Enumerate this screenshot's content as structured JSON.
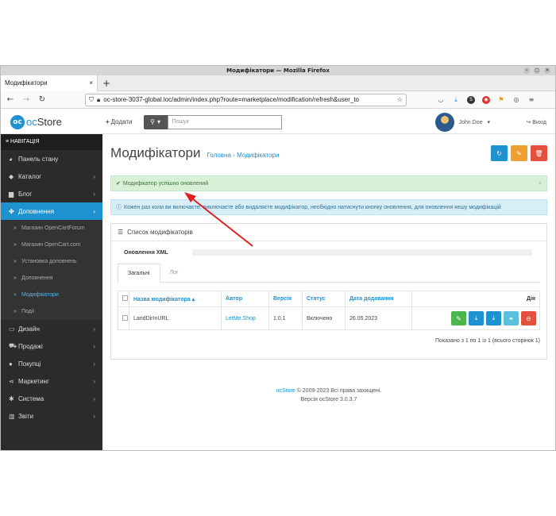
{
  "window": {
    "title": "Модифікатори — Mozilla Firefox"
  },
  "tab": {
    "label": "Модифікатори",
    "close": "×",
    "new_tab": "+"
  },
  "url": "oc-store-3037-global.loc/admin/index.php?route=marketplace/modification/refresh&user_to",
  "header": {
    "logo_mark": "oc",
    "logo_text_a": "oc",
    "logo_text_b": "Store",
    "add_label": "Додати",
    "search_placeholder": "Пошук",
    "user_name": "John Doe",
    "logout_label": "Вихід"
  },
  "sidebar": {
    "heading": "НАВІГАЦІЯ",
    "items": [
      {
        "label": "Панель стану",
        "icon": "dashboard-icon",
        "glyph": "◕",
        "chevron": ""
      },
      {
        "label": "Каталог",
        "icon": "tag-icon",
        "glyph": "◆",
        "chevron": "›"
      },
      {
        "label": "Блог",
        "icon": "book-icon",
        "glyph": "▆",
        "chevron": "›"
      },
      {
        "label": "Доповнення",
        "icon": "puzzle-icon",
        "glyph": "✤",
        "chevron": "›"
      }
    ],
    "sub_items": [
      {
        "label": "Магазин OpenCartForum"
      },
      {
        "label": "Магазин OpenCart.com"
      },
      {
        "label": "Установка доповнень"
      },
      {
        "label": "Доповнення"
      },
      {
        "label": "Модифікатори"
      },
      {
        "label": "Події"
      }
    ],
    "items2": [
      {
        "label": "Дизайн",
        "icon": "monitor-icon",
        "glyph": "▭",
        "chevron": "›"
      },
      {
        "label": "Продажі",
        "icon": "cart-icon",
        "glyph": "⛟",
        "chevron": "›"
      },
      {
        "label": "Покупці",
        "icon": "user-icon",
        "glyph": "●",
        "chevron": "›"
      },
      {
        "label": "Маркетинг",
        "icon": "share-icon",
        "glyph": "⋖",
        "chevron": "›"
      },
      {
        "label": "Система",
        "icon": "cog-icon",
        "glyph": "✱",
        "chevron": "›"
      },
      {
        "label": "Звіти",
        "icon": "bar-chart-icon",
        "glyph": "▥",
        "chevron": "›"
      }
    ]
  },
  "page": {
    "title": "Модифікатори",
    "breadcrumb_home": "Головна",
    "breadcrumb_sep": "›",
    "breadcrumb_current": "Модифікатори",
    "success": "Модифікатор успішно оновлений",
    "success_close": "×",
    "info": "Кожен раз коли ви включаєте, виключаєте або видаляєте модифікатор, необхідно натиснути кнопку оновлення, для оновлення кешу модифікацій",
    "panel_title": "Список модифікаторів",
    "xml_label": "Оновлення XML",
    "tabs": [
      "Загальні",
      "Лог"
    ],
    "columns": [
      "Назва модифікатора ▴",
      "Автор",
      "Версія",
      "Статус",
      "Дата додавання",
      "Дія"
    ],
    "rows": [
      {
        "name": "LandDirInURL",
        "author": "LetMe.Shop",
        "version": "1.0.1",
        "status": "Включено",
        "date": "26.05.2023"
      }
    ],
    "shown": "Показано з 1 по 1 із 1 (всього сторінок 1)",
    "footer_brand": "ocStore",
    "footer_rest": " © 2009-2023 Всі права захищені.",
    "footer_version": "Версія ocStore 3.0.3.7"
  },
  "colors": {
    "primary": "#1e91cf",
    "warning": "#f0a030",
    "danger": "#e3503e",
    "success": "#4cb64c"
  }
}
